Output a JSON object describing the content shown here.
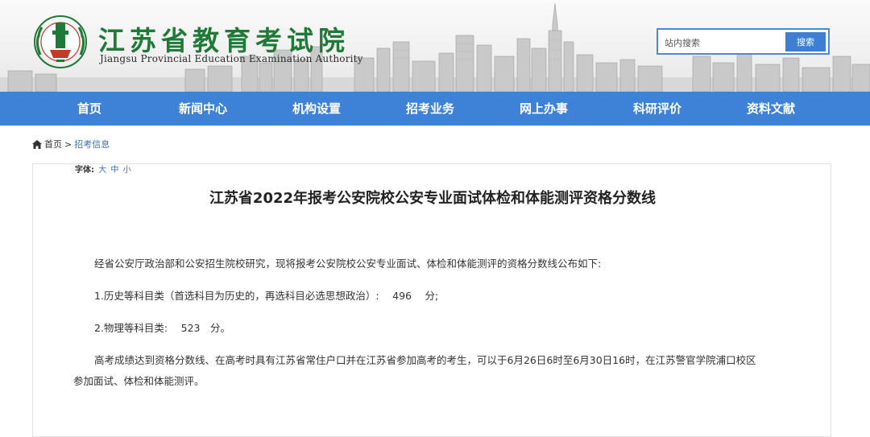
{
  "header": {
    "logo_cn": "江苏省教育考试院",
    "logo_en": "Jiangsu Provincial Education Examination Authority",
    "search": {
      "placeholder": "站内搜索",
      "button": "搜索"
    }
  },
  "nav": {
    "items": [
      "首页",
      "新闻中心",
      "机构设置",
      "招考业务",
      "网上办事",
      "科研评价",
      "资料文献"
    ]
  },
  "breadcrumb": {
    "home": "首页",
    "sep": ">",
    "current": "招考信息"
  },
  "article": {
    "font_size_label": "字体:",
    "font_size_options": [
      "大",
      "中",
      "小"
    ],
    "title": "江苏省2022年报考公安院校公安专业面试体检和体能测评资格分数线",
    "paragraphs": [
      "经省公安厅政治部和公安招生院校研究，现将报考公安院校公安专业面试、体检和体能测评的资格分数线公布如下:",
      "1.历史等科目类（首选科目为历史的，再选科目必选思想政治）:　 496　 分;",
      "2.物理等科目类:　 523　分。",
      "高考成绩达到资格分数线、在高考时具有江苏省常住户口并在江苏省参加高考的考生，可以于6月26日6时至6月30日16时，在江苏警官学院浦口校区",
      "参加面试、体检和体能测评。"
    ]
  },
  "colors": {
    "nav_bg": "#3d82d6",
    "logo_green": "#1e7a36",
    "link": "#3d6fb8"
  }
}
